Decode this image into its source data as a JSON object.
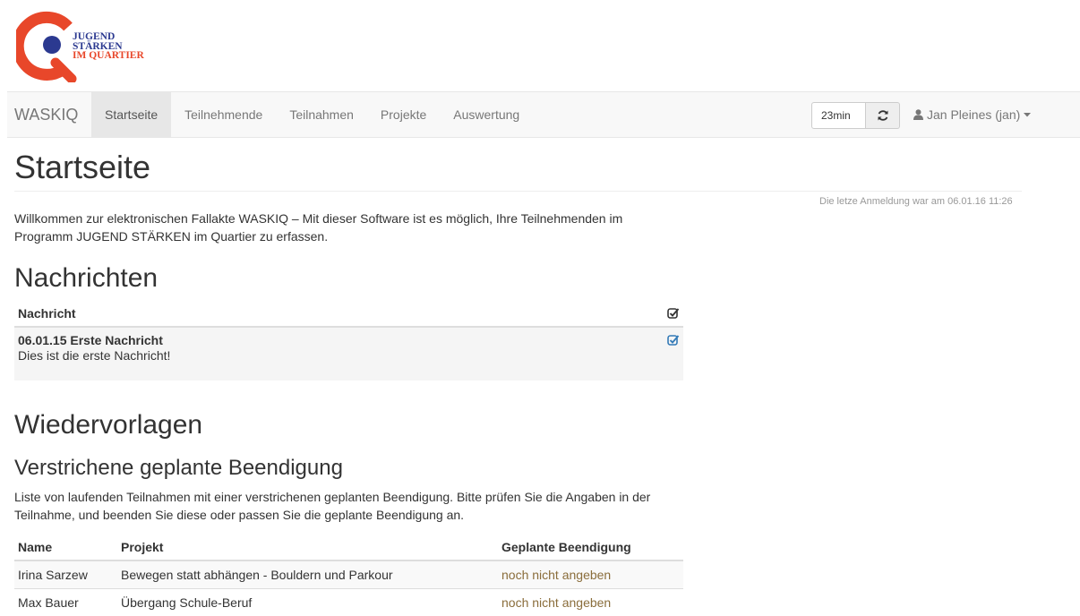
{
  "logo": {
    "line1": "JUGEND",
    "line2": "STÄRKEN",
    "line3": "IM QUARTIER",
    "ring_color": "#e8472a",
    "dot_color": "#2b3990"
  },
  "navbar": {
    "brand": "WASKIQ",
    "items": [
      {
        "label": "Startseite",
        "active": true
      },
      {
        "label": "Teilnehmende",
        "active": false
      },
      {
        "label": "Teilnahmen",
        "active": false
      },
      {
        "label": "Projekte",
        "active": false
      },
      {
        "label": "Auswertung",
        "active": false
      }
    ],
    "session_timer": "23min",
    "refresh_icon": "refresh-icon",
    "user_icon": "user-icon",
    "user_label": "Jan Pleines (jan)"
  },
  "page": {
    "title": "Startseite",
    "last_login": "Die letze Anmeldung war am 06.01.16 11:26",
    "welcome": "Willkommen zur elektronischen Fallakte WASKIQ – Mit dieser Software ist es möglich, Ihre Teilnehmenden im Programm JUGEND STÄRKEN im Quartier zu erfassen."
  },
  "messages": {
    "heading": "Nachrichten",
    "column": "Nachricht",
    "items": [
      {
        "title": "06.01.15 Erste Nachricht",
        "body": "Dies ist die erste Nachricht!"
      }
    ]
  },
  "resubmissions": {
    "heading": "Wiedervorlagen",
    "subheading": "Verstrichene geplante Beendigung",
    "description": "Liste von laufenden Teilnahmen mit einer verstrichenen geplanten Beendigung. Bitte prüfen Sie die Angaben in der Teilnahme, und beenden Sie diese oder passen Sie die geplante Beendigung an.",
    "columns": [
      "Name",
      "Projekt",
      "Geplante Beendigung"
    ],
    "rows": [
      {
        "name": "Irina Sarzew",
        "project": "Bewegen statt abhängen - Bouldern und Parkour",
        "planned_end": "noch nicht angeben"
      },
      {
        "name": "Max Bauer",
        "project": "Übergang Schule-Beruf",
        "planned_end": "noch nicht angeben"
      }
    ]
  },
  "colors": {
    "warning_text": "#8a6d3b",
    "check_active": "#337ab7"
  }
}
